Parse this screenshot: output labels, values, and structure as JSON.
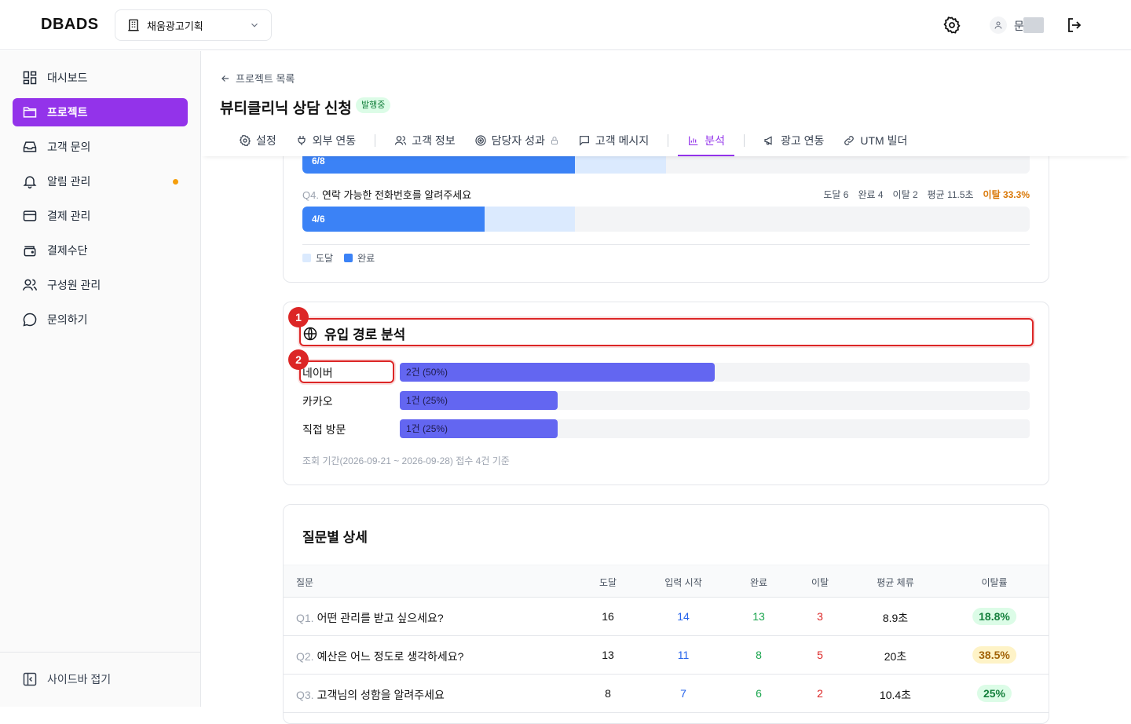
{
  "app": {
    "logo": "DBADS",
    "workspace": "채움광고기획",
    "username": "문"
  },
  "sidebar": {
    "items": [
      {
        "label": "대시보드"
      },
      {
        "label": "프로젝트"
      },
      {
        "label": "고객 문의"
      },
      {
        "label": "알림 관리"
      },
      {
        "label": "결제 관리"
      },
      {
        "label": "결제수단"
      },
      {
        "label": "구성원 관리"
      },
      {
        "label": "문의하기"
      }
    ],
    "collapse_label": "사이드바 접기"
  },
  "header": {
    "back_label": "프로젝트 목록",
    "title": "뷰티클리닉 상담 신청",
    "status": "발행중",
    "tabs": [
      {
        "label": "설정"
      },
      {
        "label": "외부 연동"
      },
      {
        "label": "고객 정보"
      },
      {
        "label": "담당자 성과"
      },
      {
        "label": "고객 메시지"
      },
      {
        "label": "분석"
      },
      {
        "label": "광고 연동"
      },
      {
        "label": "UTM 빌더"
      }
    ]
  },
  "funnel": {
    "q3_bar_label": "6/8",
    "q3_reach_fraction": 0.5,
    "q3_done_fraction": 0.375,
    "q4": {
      "num": "Q4.",
      "text": "연락 가능한 전화번호를 알려주세요",
      "stats": [
        "도달 6",
        "완료 4",
        "이탈 2",
        "평균 11.5초"
      ],
      "dropout": "이탈 33.3%",
      "bar_label": "4/6",
      "reach_fraction": 0.375,
      "done_fraction": 0.25
    },
    "legend": [
      "도달",
      "완료"
    ],
    "colors": {
      "reach": "#dbeafe",
      "done": "#3b82f6"
    }
  },
  "traffic": {
    "title": "유입 경로 분석",
    "sources": [
      {
        "label": "네이버",
        "value": "2건 (50%)",
        "fraction": 0.5
      },
      {
        "label": "카카오",
        "value": "1건 (25%)",
        "fraction": 0.25
      },
      {
        "label": "직접 방문",
        "value": "1건 (25%)",
        "fraction": 0.25
      }
    ],
    "note": "조회 기간(2026-09-21 ~ 2026-09-28) 접수 4건 기준",
    "markers": [
      "1",
      "2"
    ]
  },
  "detail": {
    "title": "질문별 상세",
    "columns": [
      "질문",
      "도달",
      "입력 시작",
      "완료",
      "이탈",
      "평균 체류",
      "이탈률"
    ],
    "rows": [
      {
        "num": "Q1.",
        "text": "어떤 관리를 받고 싶으세요?",
        "reach": "16",
        "start": "14",
        "done": "13",
        "drop": "3",
        "avg": "8.9초",
        "rate": "18.8%",
        "rate_level": "good"
      },
      {
        "num": "Q2.",
        "text": "예산은 어느 정도로 생각하세요?",
        "reach": "13",
        "start": "11",
        "done": "8",
        "drop": "5",
        "avg": "20초",
        "rate": "38.5%",
        "rate_level": "warn"
      },
      {
        "num": "Q3.",
        "text": "고객님의 성함을 알려주세요",
        "reach": "8",
        "start": "7",
        "done": "6",
        "drop": "2",
        "avg": "10.4초",
        "rate": "25%",
        "rate_level": "good"
      }
    ]
  }
}
